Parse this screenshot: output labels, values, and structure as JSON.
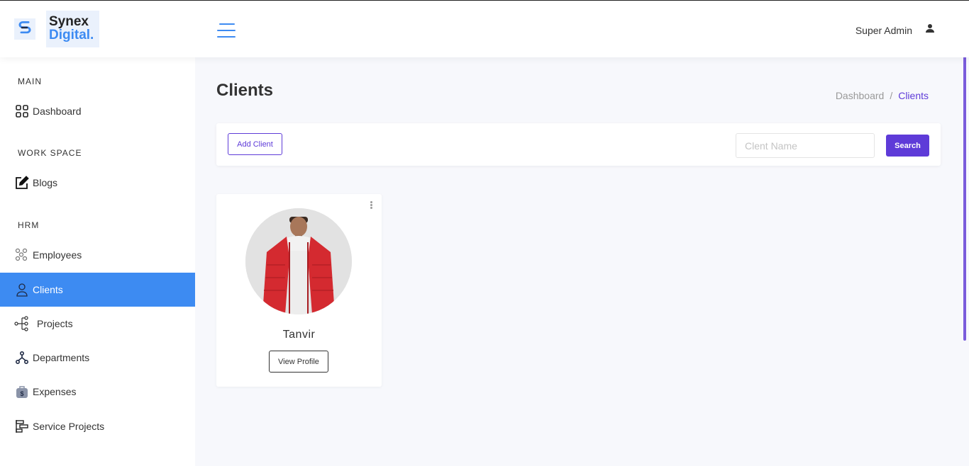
{
  "brand": {
    "line1": "Synex",
    "line2": "Digital."
  },
  "header": {
    "user_name": "Super Admin"
  },
  "sidebar": {
    "sections": [
      {
        "title": "MAIN"
      },
      {
        "title": "WORK SPACE"
      },
      {
        "title": "HRM"
      }
    ],
    "items": [
      {
        "label": "Dashboard",
        "icon": "grid-icon"
      },
      {
        "label": "Blogs",
        "icon": "edit-icon"
      },
      {
        "label": "Employees",
        "icon": "people-icon"
      },
      {
        "label": "Clients",
        "icon": "user-icon",
        "active": true
      },
      {
        "label": "Projects",
        "icon": "tree-icon"
      },
      {
        "label": "Departments",
        "icon": "hierarchy-icon"
      },
      {
        "label": "Expenses",
        "icon": "money-bag-icon"
      },
      {
        "label": "Service Projects",
        "icon": "gantt-icon"
      }
    ]
  },
  "page": {
    "title": "Clients",
    "breadcrumb": {
      "link": "Dashboard",
      "separator": "/",
      "current": "Clients"
    }
  },
  "toolbar": {
    "add_label": "Add Client",
    "search_placeholder": "Clent Name",
    "search_value": "",
    "search_label": "Search"
  },
  "clients": [
    {
      "name": "Tanvir",
      "action_label": "View Profile"
    }
  ],
  "colors": {
    "accent": "#3d8bf2",
    "primary": "#5e3bd8",
    "background": "#f7f8fc"
  }
}
